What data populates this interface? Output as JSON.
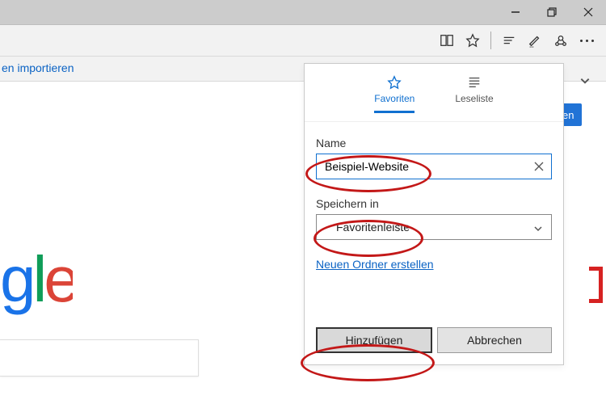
{
  "window": {
    "title": ""
  },
  "toolbar": {
    "import_link": "en importieren",
    "peek_button": "en"
  },
  "popup": {
    "tabs": {
      "favorites": "Favoriten",
      "reading_list": "Leseliste"
    },
    "name_label": "Name",
    "name_value": "Beispiel-Website",
    "save_in_label": "Speichern in",
    "save_in_value": "Favoritenleiste",
    "new_folder": "Neuen Ordner erstellen",
    "add_button": "Hinzufügen",
    "cancel_button": "Abbrechen"
  },
  "google": {
    "g": "g",
    "l": "l",
    "e": "e"
  }
}
